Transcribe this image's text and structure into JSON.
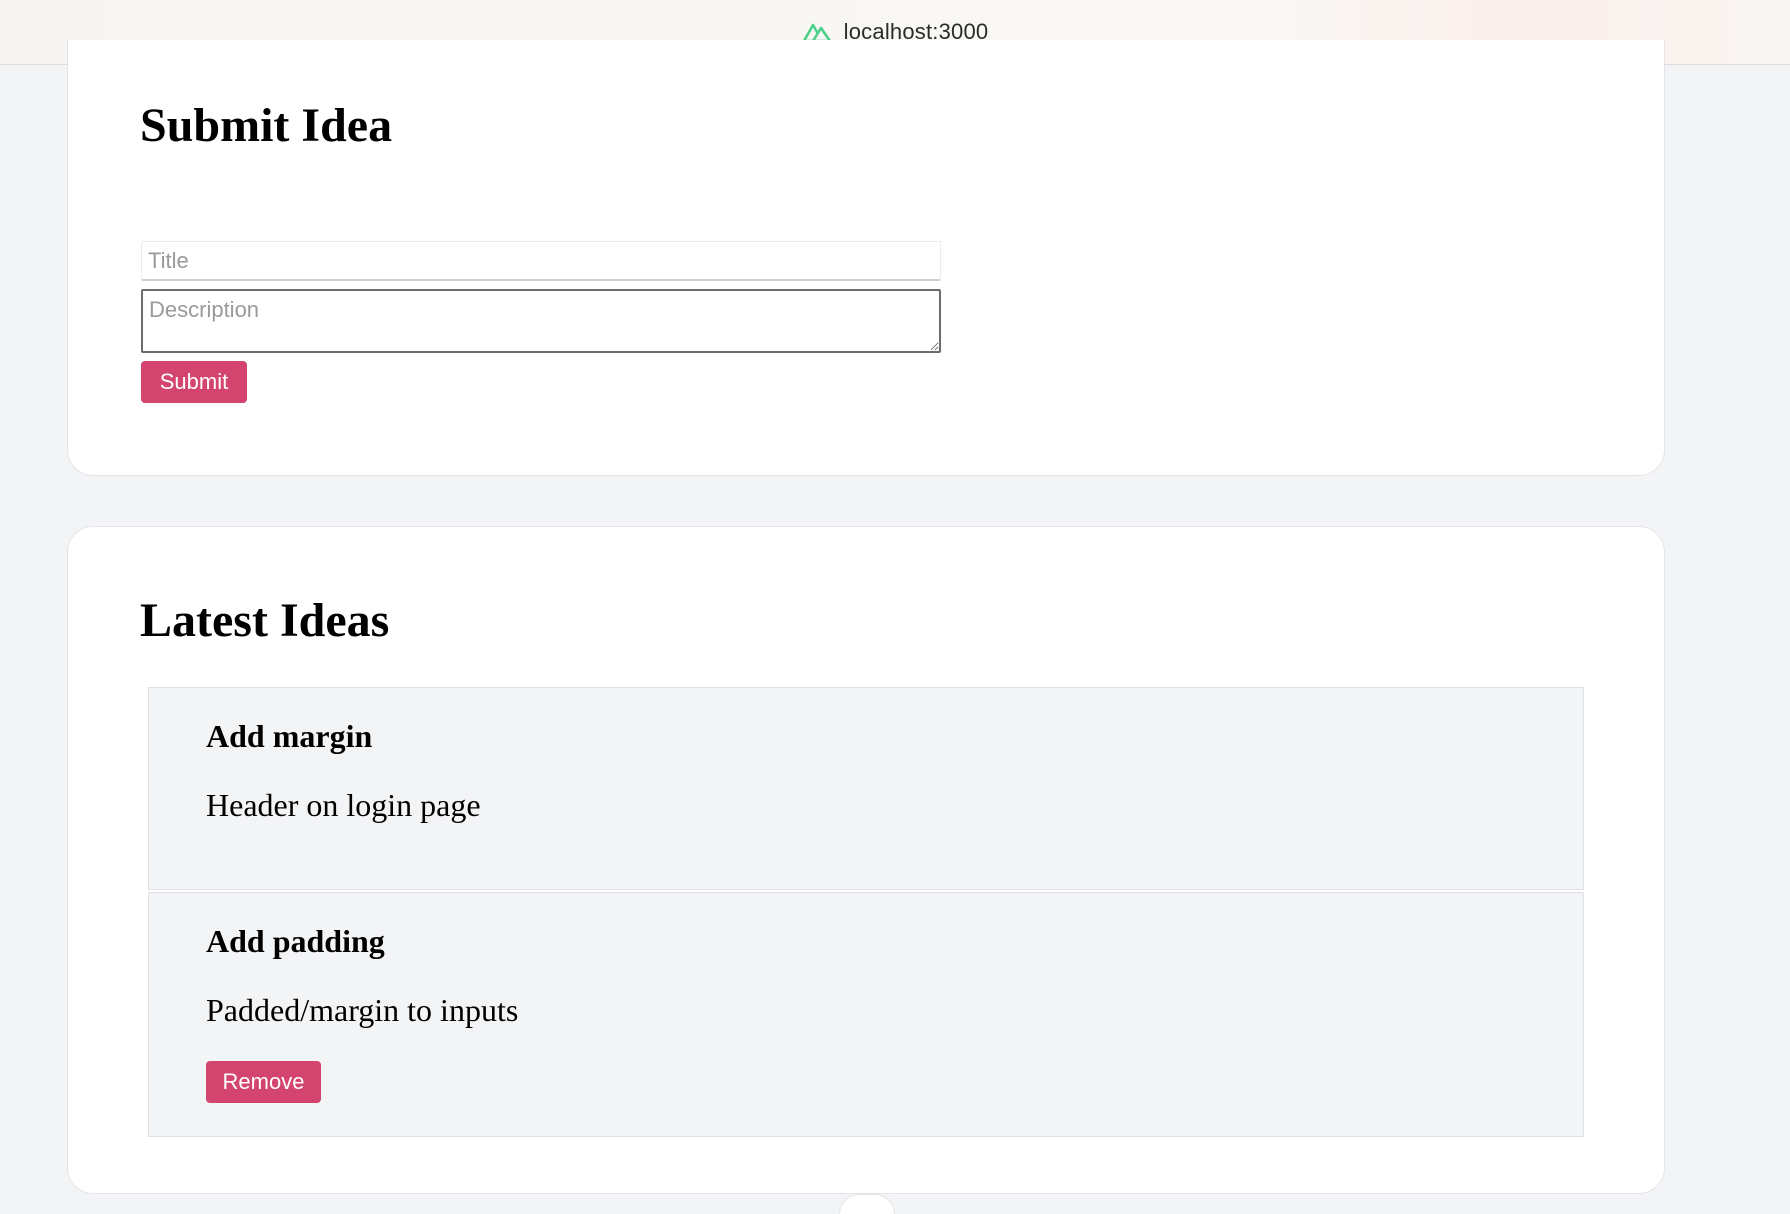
{
  "browser": {
    "url": "localhost:3000",
    "icon": "nuxt-logo-icon"
  },
  "submit_card": {
    "heading": "Submit Idea",
    "title_field": {
      "placeholder": "Title",
      "value": ""
    },
    "description_field": {
      "placeholder": "Description",
      "value": ""
    },
    "submit_label": "Submit"
  },
  "latest_card": {
    "heading": "Latest Ideas",
    "ideas": [
      {
        "title": "Add margin",
        "description": "Header on login page"
      },
      {
        "title": "Add padding",
        "description": "Padded/margin to inputs",
        "remove_label": "Remove"
      }
    ]
  },
  "colors": {
    "accent": "#d3446f",
    "page_background": "#f3f4f6",
    "card_background": "#ffffff",
    "nuxt_green": "#00dc82"
  }
}
